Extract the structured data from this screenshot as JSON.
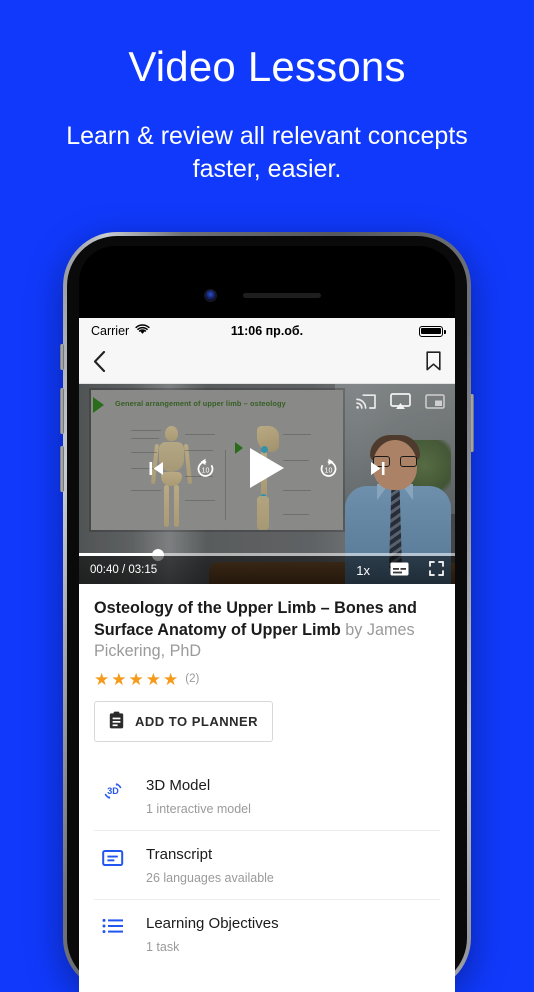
{
  "promo": {
    "title": "Video Lessons",
    "subtitle": "Learn & review all relevant concepts faster, easier."
  },
  "theme": {
    "background": "#1039fb",
    "accent_blue": "#2355f0",
    "star_color": "#f59b1c"
  },
  "phone": {
    "status_bar": {
      "carrier": "Carrier",
      "wifi_icon": "wifi-icon",
      "time": "11:06 пр.об.",
      "battery_icon": "battery-full-icon"
    },
    "nav_bar": {
      "back_icon": "chevron-left-icon",
      "bookmark_icon": "bookmark-icon"
    },
    "video": {
      "slide_title": "General arrangement of upper limb – osteology",
      "top_icons": [
        "cast-icon",
        "airplay-icon",
        "picture-in-picture-icon"
      ],
      "controls": [
        "skip-previous-icon",
        "replay-10-icon",
        "play-icon",
        "forward-10-icon",
        "skip-next-icon"
      ],
      "replay_seconds": "10",
      "forward_seconds": "10",
      "current_time": "00:40",
      "duration": "03:15",
      "time_display": "00:40 / 03:15",
      "progress_percent": 21,
      "speed": "1x",
      "captions_icon": "captions-icon",
      "fullscreen_icon": "fullscreen-icon"
    },
    "lesson": {
      "title": "Osteology of the Upper Limb – Bones and Surface Anatomy of Upper Limb",
      "by_label": "by",
      "author": "James Pickering, PhD",
      "stars": [
        "★",
        "★",
        "★",
        "★",
        "★"
      ],
      "rating_count": "(2)",
      "planner_button": {
        "label": "ADD TO PLANNER",
        "icon": "clipboard-icon"
      }
    },
    "resources": [
      {
        "icon": "3d-model-icon",
        "title": "3D Model",
        "subtitle": "1 interactive model"
      },
      {
        "icon": "transcript-icon",
        "title": "Transcript",
        "subtitle": "26 languages available"
      },
      {
        "icon": "learning-objectives-icon",
        "title": "Learning Objectives",
        "subtitle": "1 task"
      }
    ]
  }
}
